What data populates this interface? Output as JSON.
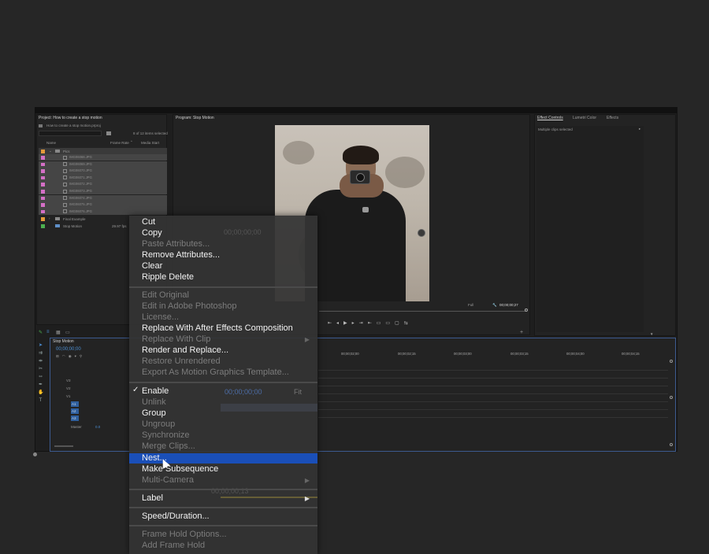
{
  "project": {
    "title": "Project: How to create a stop motion",
    "file": "How to create a stop motion.prproj",
    "count": "8 of 12 items selected",
    "col_name": "Name",
    "col_rate": "Frame Rate",
    "col_start": "Media Start",
    "folder_pics": "Pics",
    "files": [
      "IMG06068.JPG",
      "IMG06069.JPG",
      "IMG06070.JPG",
      "IMG06071.JPG",
      "IMG06072.JPG",
      "IMG06073.JPG",
      "IMG06074.JPG",
      "IMG06075.JPG",
      "IMG06076.JPG"
    ],
    "folder_final": "Final Example",
    "seq_name": "Stop Motion",
    "seq_rate": "29.97 fps"
  },
  "program": {
    "title": "Program: Stop Motion",
    "fit": "Full",
    "timecode": "00;00;00;27",
    "timecode_behind": "00;00;00;00"
  },
  "effects": {
    "tab_controls": "Effect Controls",
    "tab_lumetri": "Lumetri Color",
    "tab_effects": "Effects",
    "info": "Multiple clips selected"
  },
  "timeline": {
    "title": "Stop Motion",
    "timecode": "00;00;00;00",
    "ruler": [
      "00;00;02;00",
      "00;00;02;15",
      "00;00;03;00",
      "00;00;03;15",
      "00;00;04;00",
      "00;00;04;15"
    ],
    "tracks_video": [
      "V3",
      "V2",
      "V1"
    ],
    "tracks_audio": [
      "A1",
      "A2",
      "A3"
    ],
    "master": "Master",
    "master_val": "0.0"
  },
  "ghost": {
    "timecode": "00;00;00;00",
    "fit": "Fit",
    "tc2": "00;00;00;13"
  },
  "menu": {
    "cut": "Cut",
    "copy": "Copy",
    "paste_attr": "Paste Attributes...",
    "remove_attr": "Remove Attributes...",
    "clear": "Clear",
    "ripple": "Ripple Delete",
    "edit_original": "Edit Original",
    "edit_ps": "Edit in Adobe Photoshop",
    "license": "License...",
    "replace_ae": "Replace With After Effects Composition",
    "replace_clip": "Replace With Clip",
    "render_replace": "Render and Replace...",
    "restore": "Restore Unrendered",
    "export_mgt": "Export As Motion Graphics Template...",
    "enable": "Enable",
    "unlink": "Unlink",
    "group": "Group",
    "ungroup": "Ungroup",
    "synchronize": "Synchronize",
    "merge": "Merge Clips...",
    "nest": "Nest...",
    "make_sub": "Make Subsequence",
    "multicam": "Multi-Camera",
    "label": "Label",
    "speed": "Speed/Duration...",
    "frame_hold_opts": "Frame Hold Options...",
    "add_frame_hold": "Add Frame Hold"
  },
  "colors": {
    "highlight": "#1a4fb8",
    "label_pink": "#d46fc6",
    "label_orange": "#e49a3a",
    "label_green": "#4caf50",
    "timeline_border": "#3c5a8f"
  }
}
